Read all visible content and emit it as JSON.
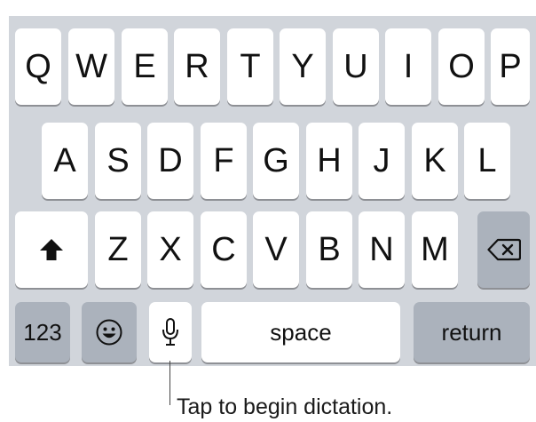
{
  "keyboard": {
    "row1": [
      "Q",
      "W",
      "E",
      "R",
      "T",
      "Y",
      "U",
      "I",
      "O",
      "P"
    ],
    "row2": [
      "A",
      "S",
      "D",
      "F",
      "G",
      "H",
      "J",
      "K",
      "L"
    ],
    "row3": [
      "Z",
      "X",
      "C",
      "V",
      "B",
      "N",
      "M"
    ],
    "numbers_label": "123",
    "space_label": "space",
    "return_label": "return",
    "icons": {
      "shift": "shift-arrow-icon",
      "delete": "backspace-icon",
      "emoji": "emoji-icon",
      "dictation": "microphone-icon"
    },
    "colors": {
      "keyboard_bg": "#d1d5db",
      "letter_key": "#ffffff",
      "function_key": "#abb2bc"
    }
  },
  "callout": {
    "text": "Tap to begin dictation."
  }
}
